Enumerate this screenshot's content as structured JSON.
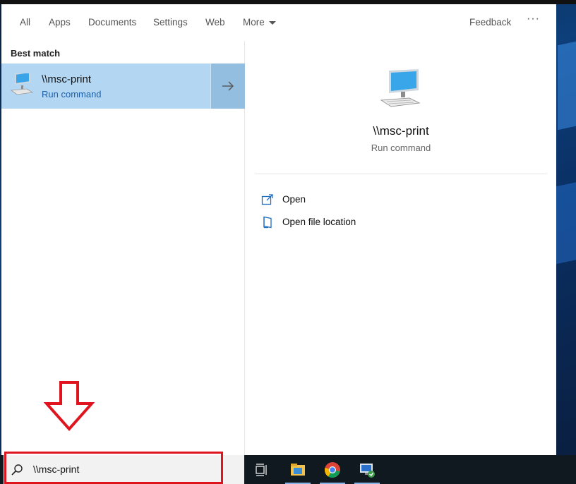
{
  "tabs": {
    "all": "All",
    "apps": "Apps",
    "documents": "Documents",
    "settings": "Settings",
    "web": "Web",
    "more": "More",
    "feedback": "Feedback",
    "dots": "···"
  },
  "left": {
    "section_label": "Best match",
    "result": {
      "title": "\\\\msc-print",
      "subtitle": "Run command"
    }
  },
  "right": {
    "title": "\\\\msc-print",
    "subtitle": "Run command",
    "actions": [
      {
        "label": "Open",
        "icon": "open-icon"
      },
      {
        "label": "Open file location",
        "icon": "file-location-icon"
      }
    ]
  },
  "taskbar": {
    "search_value": "\\\\msc-print",
    "icons": [
      "task-view-icon",
      "file-explorer-icon",
      "chrome-icon",
      "remote-desktop-icon"
    ]
  },
  "colors": {
    "selected_result": "#b3d7f3",
    "arrow_button": "#93bee0",
    "link_blue": "#1b5fa8",
    "annotation_red": "#e0141e"
  }
}
